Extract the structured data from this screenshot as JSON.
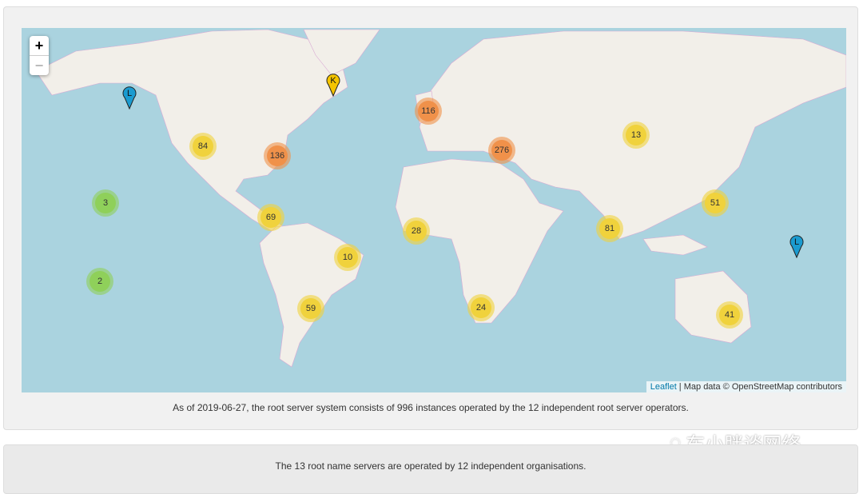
{
  "map": {
    "zoom_in": "+",
    "zoom_out": "−",
    "clusters": [
      {
        "count": "84",
        "color": "#f0d23c"
      },
      {
        "count": "136",
        "color": "#f0914a"
      },
      {
        "count": "3",
        "color": "#8fd05a"
      },
      {
        "count": "2",
        "color": "#8fd05a"
      },
      {
        "count": "69",
        "color": "#f0d23c"
      },
      {
        "count": "10",
        "color": "#f0d23c"
      },
      {
        "count": "59",
        "color": "#f0d23c"
      },
      {
        "count": "28",
        "color": "#f0d23c"
      },
      {
        "count": "24",
        "color": "#f0d23c"
      },
      {
        "count": "116",
        "color": "#f0914a"
      },
      {
        "count": "276",
        "color": "#f0914a"
      },
      {
        "count": "13",
        "color": "#f0d23c"
      },
      {
        "count": "51",
        "color": "#f0d23c"
      },
      {
        "count": "81",
        "color": "#f0d23c"
      },
      {
        "count": "41",
        "color": "#f0d23c"
      }
    ],
    "markers": [
      {
        "letter": "L",
        "color": "#1a9bd0"
      },
      {
        "letter": "K",
        "color": "#f5c400"
      },
      {
        "letter": "L",
        "color": "#1a9bd0"
      }
    ],
    "attribution": {
      "leaflet": "Leaflet",
      "sep": " | ",
      "text": "Map data © OpenStreetMap contributors"
    }
  },
  "caption": "As of 2019-06-27, the root server system consists of 996 instances operated by the 12 independent root server operators.",
  "second_panel": "The 13 root name servers are operated by 12 independent organisations.",
  "watermark": "车小胖谈网络"
}
